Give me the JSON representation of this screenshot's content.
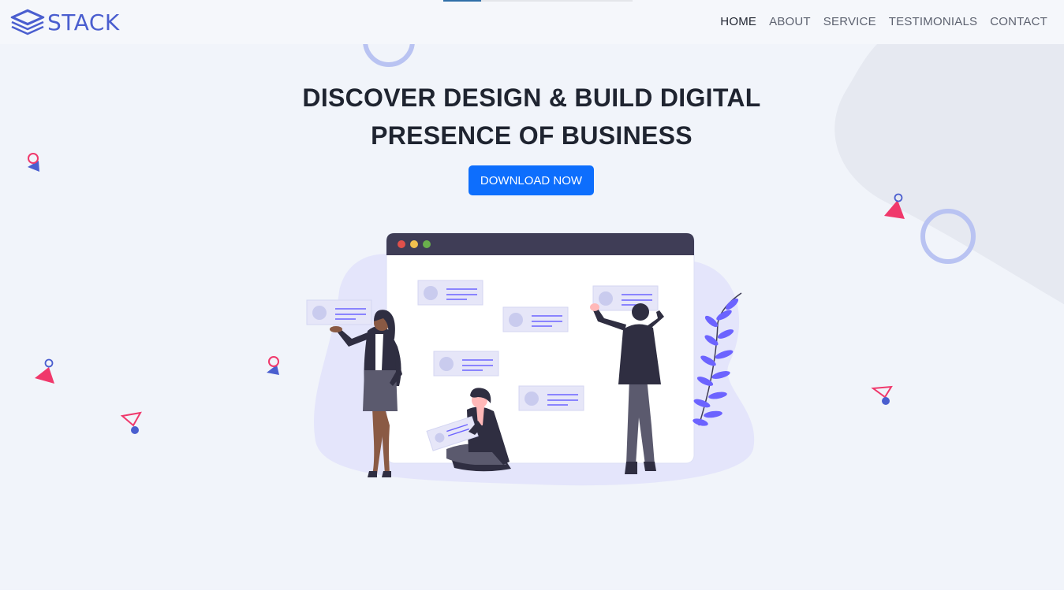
{
  "brand": {
    "name": "STACK",
    "icon": "stacked-layers-icon"
  },
  "nav": {
    "items": [
      {
        "label": "HOME",
        "active": true
      },
      {
        "label": "ABOUT",
        "active": false
      },
      {
        "label": "SERVICE",
        "active": false
      },
      {
        "label": "TESTIMONIALS",
        "active": false
      },
      {
        "label": "CONTACT",
        "active": false
      }
    ]
  },
  "hero": {
    "title_line1": "DISCOVER DESIGN & BUILD DIGITAL",
    "title_line2": "PRESENCE OF BUSINESS",
    "cta_label": "DOWNLOAD NOW",
    "illustration": "team-building-website-illustration"
  },
  "colors": {
    "brand": "#4a5ecf",
    "accent": "#0d6efd",
    "hero_bg": "#f1f4fa",
    "shape_pink": "#f0386b",
    "shape_blue": "#4a5ecf",
    "ring": "#b9c3f2"
  }
}
